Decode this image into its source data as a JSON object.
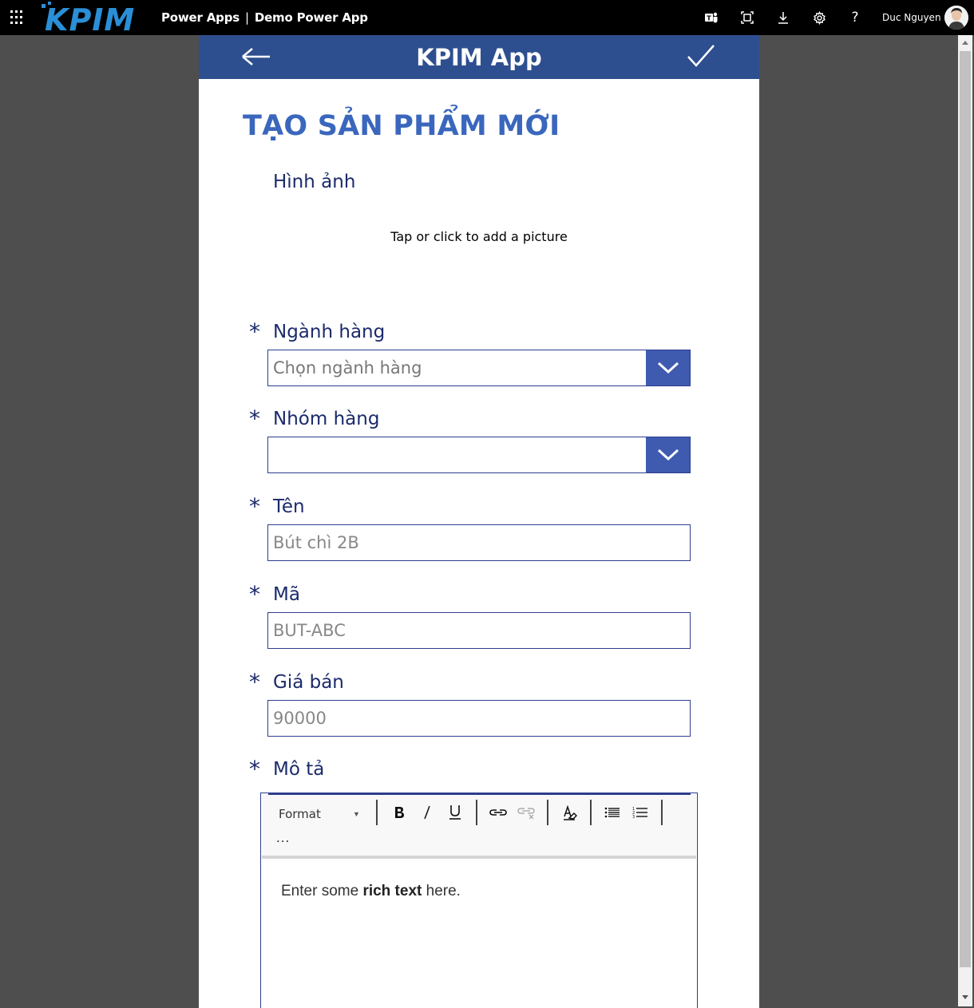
{
  "topbar": {
    "logo_text": "KPIM",
    "product": "Power Apps",
    "separator": "|",
    "app_name": "Demo Power App",
    "icons": [
      "teams-icon",
      "fit-screen-icon",
      "download-icon",
      "settings-icon",
      "help-icon"
    ],
    "help_glyph": "?",
    "user_name": "Duc Nguyen"
  },
  "app": {
    "header_title": "KPIM App",
    "page_title": "TẠO SẢN PHẨM MỚI",
    "image_label": "Hình ảnh",
    "image_hint": "Tap or click to add a picture",
    "required_marker": "*",
    "fields": {
      "category": {
        "label": "Ngành hàng",
        "value": "Chọn ngành hàng"
      },
      "group": {
        "label": "Nhóm hàng",
        "value": ""
      },
      "name": {
        "label": "Tên",
        "placeholder": "Bút chì 2B"
      },
      "code": {
        "label": "Mã",
        "placeholder": "BUT-ABC"
      },
      "price": {
        "label": "Giá bán",
        "placeholder": "90000"
      },
      "description": {
        "label": "Mô tả"
      }
    },
    "rich_text": {
      "format_label": "Format",
      "more": "...",
      "body_before": "Enter some ",
      "body_bold": "rich text",
      "body_after": " here."
    }
  },
  "colors": {
    "header_bg": "#2e4f8f",
    "title_blue": "#3a67bd",
    "label_navy": "#1b2a6b",
    "chevron_bg": "#3f5bb0"
  }
}
